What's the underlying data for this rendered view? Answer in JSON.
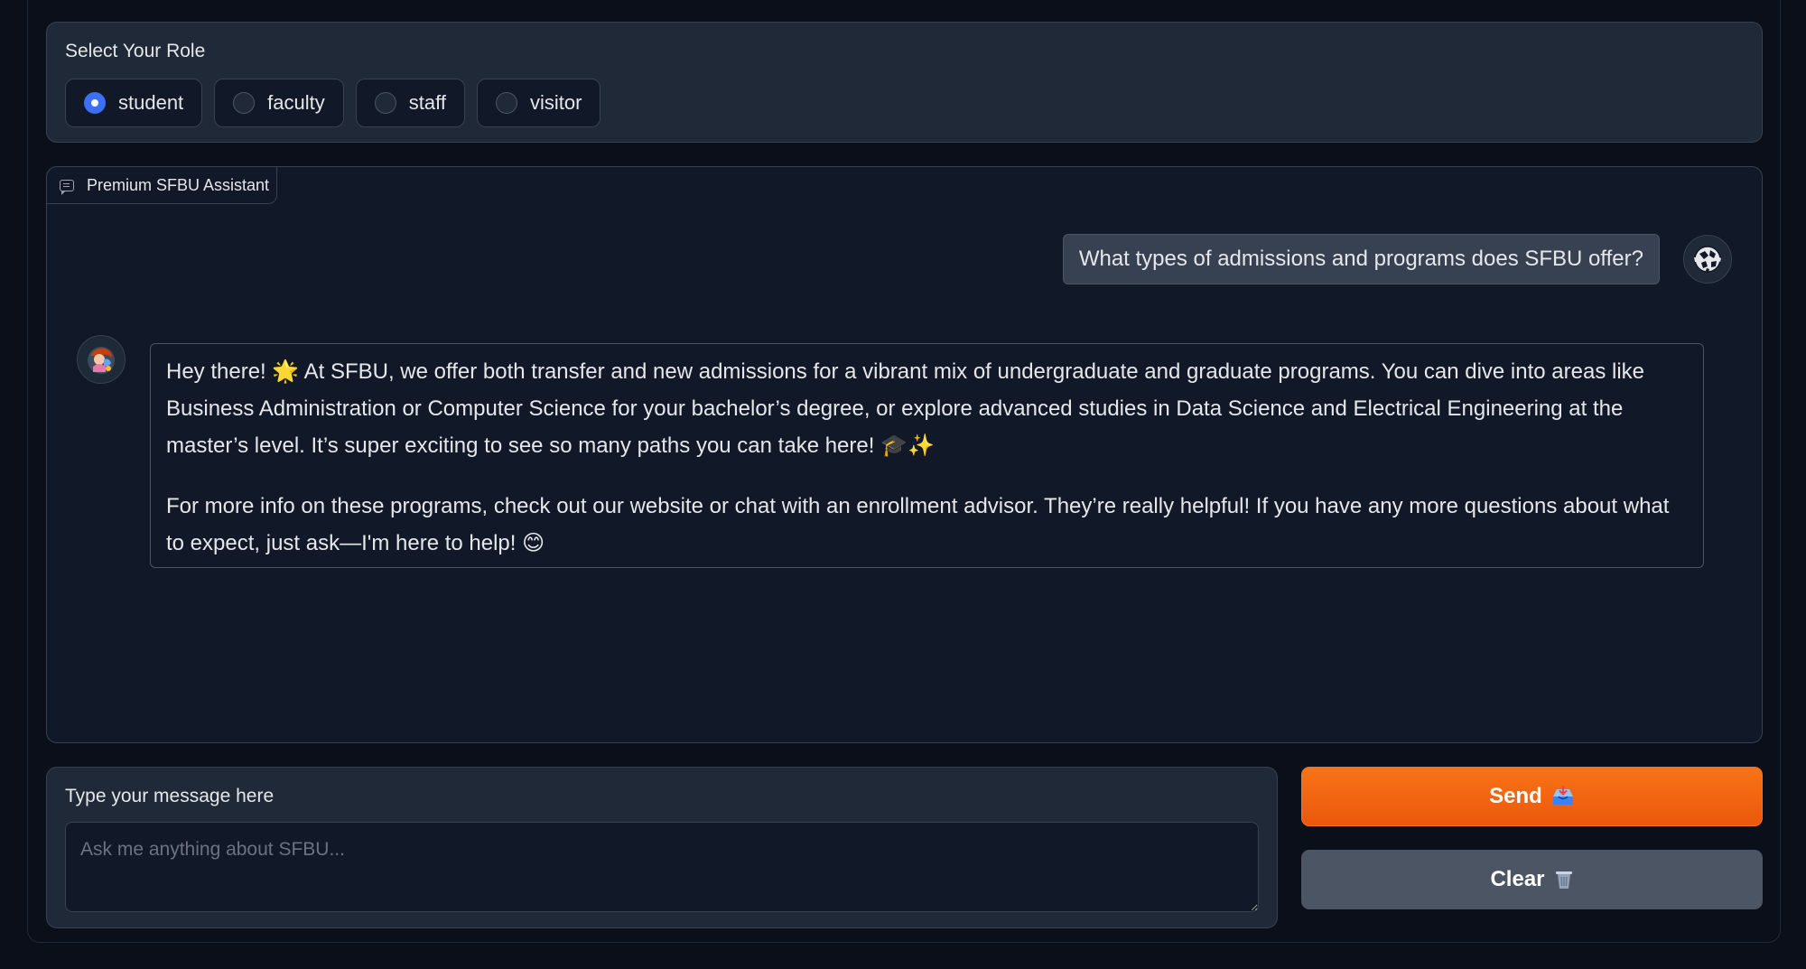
{
  "role_selector": {
    "title": "Select Your Role",
    "options": [
      {
        "label": "student",
        "checked": true
      },
      {
        "label": "faculty",
        "checked": false
      },
      {
        "label": "staff",
        "checked": false
      },
      {
        "label": "visitor",
        "checked": false
      }
    ]
  },
  "chat": {
    "tag_label": "Premium SFBU Assistant",
    "tag_icon": "chat-icon",
    "messages": [
      {
        "role": "user",
        "text": "What types of admissions and programs does SFBU offer?"
      },
      {
        "role": "assistant",
        "paragraphs": [
          "Hey there! 🌟 At SFBU, we offer both transfer and new admissions for a vibrant mix of undergraduate and graduate programs. You can dive into areas like Business Administration or Computer Science for your bachelor’s degree, or explore advanced studies in Data Science and Electrical Engineering at the master’s level. It’s super exciting to see so many paths you can take here! 🎓✨",
          "For more info on these programs, check out our website or chat with an enrollment advisor. They’re really helpful! If you have any more questions about what to expect, just ask—I'm here to help! 😊"
        ]
      }
    ]
  },
  "input": {
    "label": "Type your message here",
    "placeholder": "Ask me anything about SFBU...",
    "value": ""
  },
  "buttons": {
    "send_label": "Send",
    "send_icon": "inbox-tray-icon",
    "clear_label": "Clear",
    "clear_icon": "wastebasket-icon"
  },
  "colors": {
    "background": "#0b0f19",
    "panel": "#1f2937",
    "accent_radio": "#3b6ff5",
    "send_button": "#f97316",
    "clear_button": "#4b5563"
  }
}
